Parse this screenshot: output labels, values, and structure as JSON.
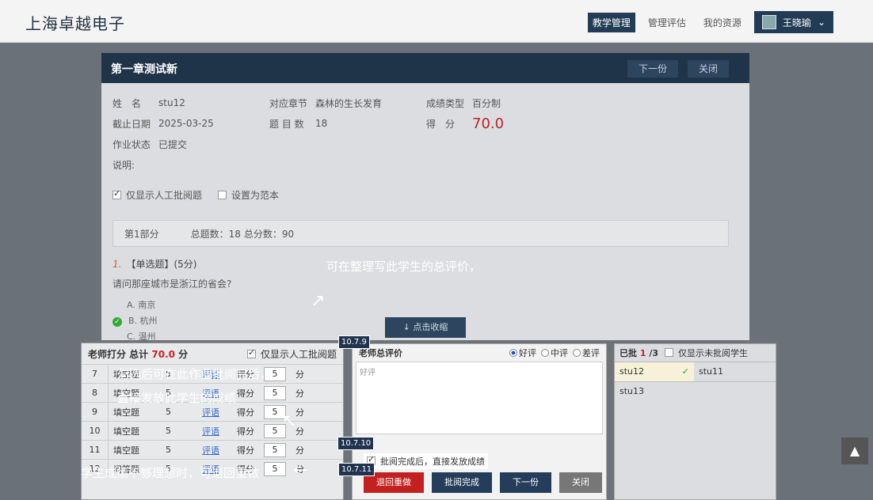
{
  "header": {
    "brand": "上海卓越电子",
    "nav": [
      "教学管理",
      "管理评估",
      "我的资源"
    ],
    "user": "王晓瑜"
  },
  "panel": {
    "title": "第一章测试新",
    "next_label": "下一份",
    "close_label": "关闭",
    "info": {
      "name_label": "姓　名",
      "name": "stu12",
      "chapter_label": "对应章节",
      "chapter": "森林的生长发育",
      "type_label": "成绩类型",
      "type": "百分制",
      "due_label": "截止日期",
      "due": "2025-03-25",
      "count_label": "题 目 数",
      "count": "18",
      "score_label": "得　分",
      "score": "70.0",
      "status_label": "作业状态",
      "status": "已提交",
      "note_label": "说明:"
    },
    "options": {
      "manual_only": "仅显示人工批阅题",
      "set_template": "设置为范本"
    },
    "part": {
      "name": "第1部分",
      "total_q": "总题数：18",
      "total_score": "总分数：90"
    },
    "question": {
      "num": "1.",
      "type": "【单选题】(5分)",
      "text": "请问那座城市是浙江的省会?",
      "optA": "A. 南京",
      "optB": "B. 杭州",
      "optC": "C. 温州"
    },
    "collapse": "↓ 点击收缩"
  },
  "annotations": {
    "a1": "可在整理写此学生的总评价，",
    "a2": "勾选后可在此作业批阅完后，",
    "a3": "直接发放此学生的成绩",
    "a4": "学生成绩不够理想时，可退回重做",
    "t1": "10.7.9",
    "t2": "10.7.10",
    "t3": "10.7.11"
  },
  "left_table": {
    "title_a": "老师打分 总计",
    "total": "70.0",
    "unit": "分",
    "manual_only": "仅显示人工批阅题",
    "rows": [
      {
        "n": "7",
        "type": "填空题",
        "pts": "5",
        "link": "评语",
        "lbl": "得分",
        "val": "5",
        "u": "分"
      },
      {
        "n": "8",
        "type": "填空题",
        "pts": "5",
        "link": "评语",
        "lbl": "得分",
        "val": "5",
        "u": "分"
      },
      {
        "n": "9",
        "type": "填空题",
        "pts": "5",
        "link": "评语",
        "lbl": "得分",
        "val": "5",
        "u": "分"
      },
      {
        "n": "10",
        "type": "填空题",
        "pts": "5",
        "link": "评语",
        "lbl": "得分",
        "val": "5",
        "u": "分"
      },
      {
        "n": "11",
        "type": "填空题",
        "pts": "5",
        "link": "评语",
        "lbl": "得分",
        "val": "5",
        "u": "分"
      },
      {
        "n": "12",
        "type": "问答题",
        "pts": "5",
        "link": "评语",
        "lbl": "得分",
        "val": "5",
        "u": "分"
      }
    ]
  },
  "eval": {
    "title": "老师总评价",
    "r1": "好评",
    "r2": "中评",
    "r3": "差评",
    "placeholder": "好评",
    "publish": "批阅完成后，直接发放成绩",
    "b_return": "退回重做",
    "b_done": "批阅完成",
    "b_next": "下一份",
    "b_close": "关闭"
  },
  "right": {
    "checked_label": "已批",
    "checked": "1",
    "total": "/3",
    "unreviewed": "仅显示未批阅学生",
    "students": [
      "stu12",
      "stu11",
      "stu13"
    ]
  }
}
